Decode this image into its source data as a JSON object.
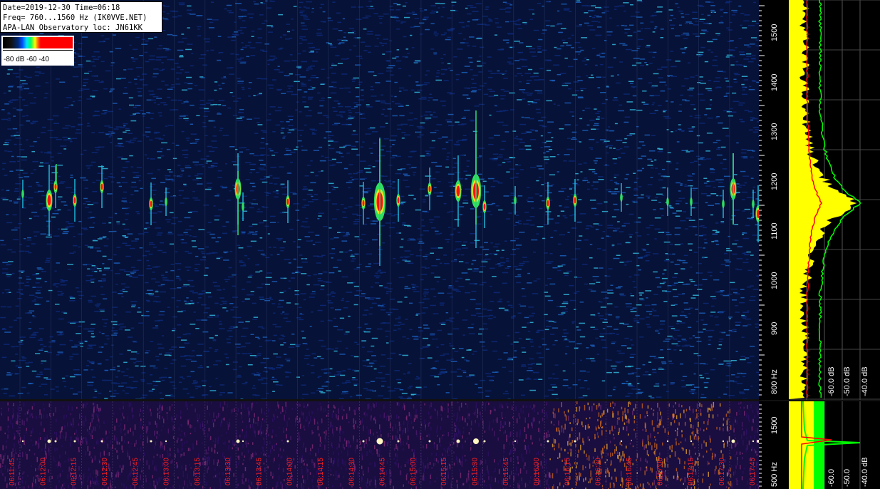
{
  "info": {
    "line1": "Date=2019-12-30 Time=06:18",
    "line2": "Freq= 760...1560 Hz (IK0VVE.NET)",
    "line3": "APA-LAN Observatory loc: JN61KK"
  },
  "scale": {
    "labels": "-80 dB -60      -40"
  },
  "freq_axis_upper": {
    "ticks": [
      "1500",
      "1400",
      "1300",
      "1200",
      "1100",
      "1000",
      "900",
      "800 Hz"
    ]
  },
  "freq_axis_lower": {
    "ticks": [
      "1500",
      "500 Hz"
    ]
  },
  "spectrum_upper": {
    "db_labels": [
      "-60.0 dB",
      "-50.0 dB",
      "-40.0 dB"
    ]
  },
  "spectrum_lower": {
    "db_labels": [
      "-60.0",
      "-50.0",
      "-40.0 dB"
    ]
  },
  "time_labels": [
    "06:11:45",
    "06:12:00",
    "06:12:15",
    "06:12:30",
    "06:12:45",
    "06:13:00",
    "06:13:15",
    "06:13:30",
    "06:13:45",
    "06:14:00",
    "06:14:15",
    "06:14:30",
    "06:14:45",
    "06:15:00",
    "06:15:15",
    "06:15:30",
    "06:15:45",
    "06:16:00",
    "06:16:15",
    "06:16:30",
    "06:16:45",
    "06:17:00",
    "06:17:15",
    "06:17:30",
    "06:17:45"
  ],
  "colors": {
    "waterfall_bg": "#071238",
    "signal_peak": "#ff0000",
    "time_label": "#ff2020",
    "spectrum_yellow": "#ffff00",
    "spectrum_green": "#00ff00",
    "spectrum_red": "#ff0000"
  }
}
